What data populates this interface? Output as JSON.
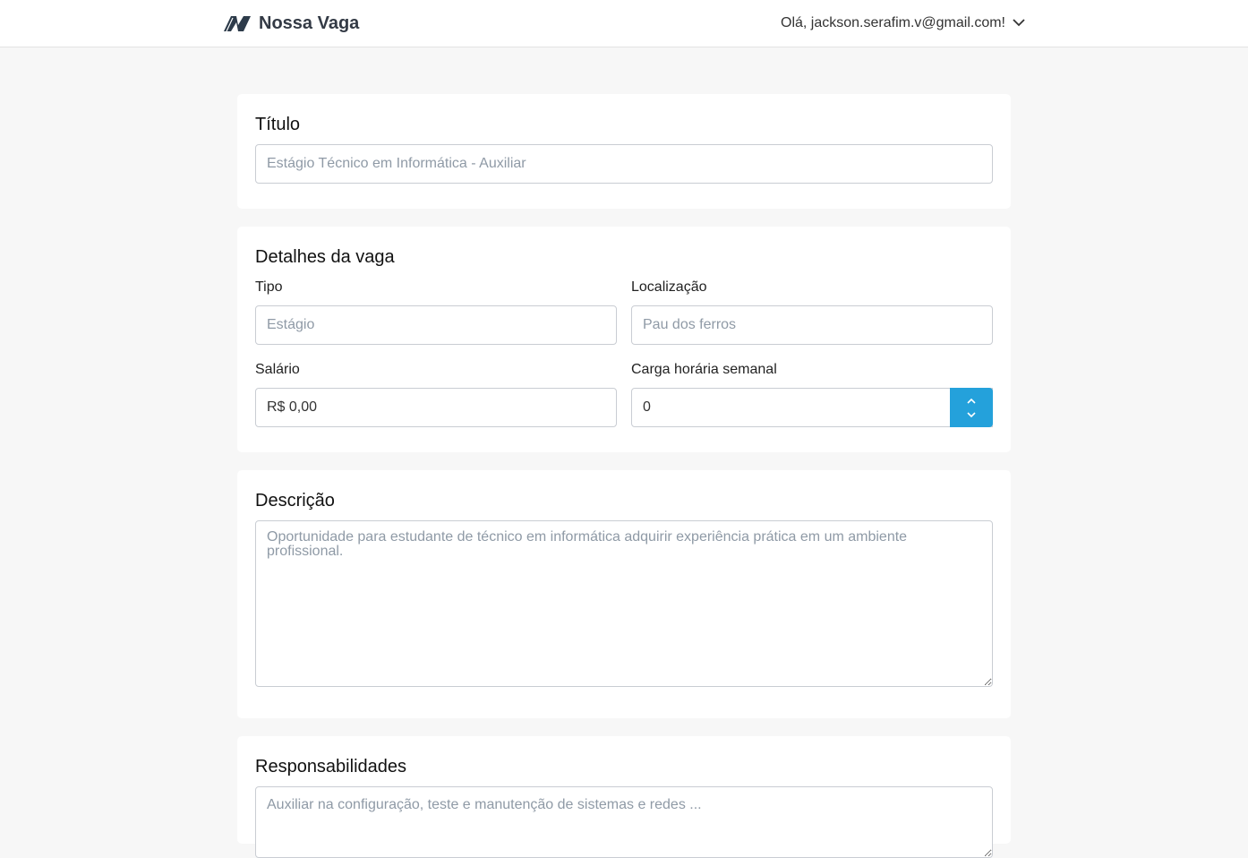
{
  "header": {
    "brand_name": "Nossa Vaga",
    "user_greeting": "Olá, jackson.serafim.v@gmail.com!"
  },
  "titulo": {
    "heading": "Título",
    "placeholder": "Estágio Técnico em Informática - Auxiliar"
  },
  "detalhes": {
    "heading": "Detalhes da vaga",
    "tipo_label": "Tipo",
    "tipo_placeholder": "Estágio",
    "localizacao_label": "Localização",
    "localizacao_placeholder": "Pau dos ferros",
    "salario_label": "Salário",
    "salario_value": "R$ 0,00",
    "carga_label": "Carga horária semanal",
    "carga_value": "0"
  },
  "descricao": {
    "heading": "Descrição",
    "placeholder": "Oportunidade para estudante de técnico em informática adquirir experiência prática em um ambiente profissional."
  },
  "responsabilidades": {
    "heading": "Responsabilidades",
    "placeholder": "Auxiliar na configuração, teste e manutenção de sistemas e redes ..."
  },
  "colors": {
    "accent": "#24a1db",
    "brand_dark": "#333a45"
  },
  "icons": {
    "logo": "nossa-vaga-logo-icon",
    "user_menu": "chevron-down-icon",
    "stepper_up": "chevron-up-icon",
    "stepper_down": "chevron-down-icon"
  }
}
